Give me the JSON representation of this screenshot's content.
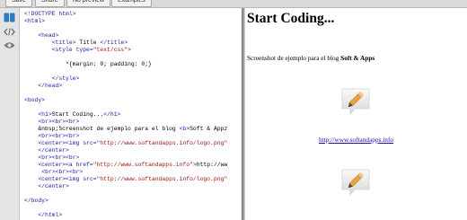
{
  "toolbar": {
    "buttons": [
      "Save",
      "Share",
      "No preview",
      "Examples"
    ]
  },
  "rail": {
    "icons": [
      "layout-icon",
      "code-icon",
      "eye-icon"
    ]
  },
  "editor": {
    "lines": [
      "<!DOCTYPE html>",
      "<html>",
      "",
      "    <head>",
      "        <title> Title </title>",
      "        <style type=\"text/css\">",
      "",
      "            *{margin: 0; padding: 0;}",
      "",
      "        </style>",
      "    </head>",
      "",
      "<body>",
      "",
      "    <h1>Start Coding...</h1>",
      "    <br><br><br>",
      "    &nbsp;Screenshot de ejemplo para el blog <b>Soft & Appz",
      "    <br><br><br>",
      "    <center><img src=\"http://www.softandapps.info/logo.png\"",
      "    </center>",
      "    <br><br><br>",
      "    <center><a href=\"http://www.softandapps.info\">http://ww",
      "     <br><br><br>",
      "    <center><img src=\"http://www.softandapps.info/logo.png\"",
      "    </center>",
      "",
      "</body>",
      "",
      "    </html>"
    ]
  },
  "preview": {
    "title": "Start Coding...",
    "intro_text": "Screenshot de ejemplo para el blog ",
    "intro_bold": "Soft & Apps",
    "link_text": "http://www.softandapps.info"
  },
  "colors": {
    "tag": "#1a1aa6",
    "attr_value": "#a31515",
    "link": "#1a0dab",
    "pencil": "#e8a33c"
  }
}
